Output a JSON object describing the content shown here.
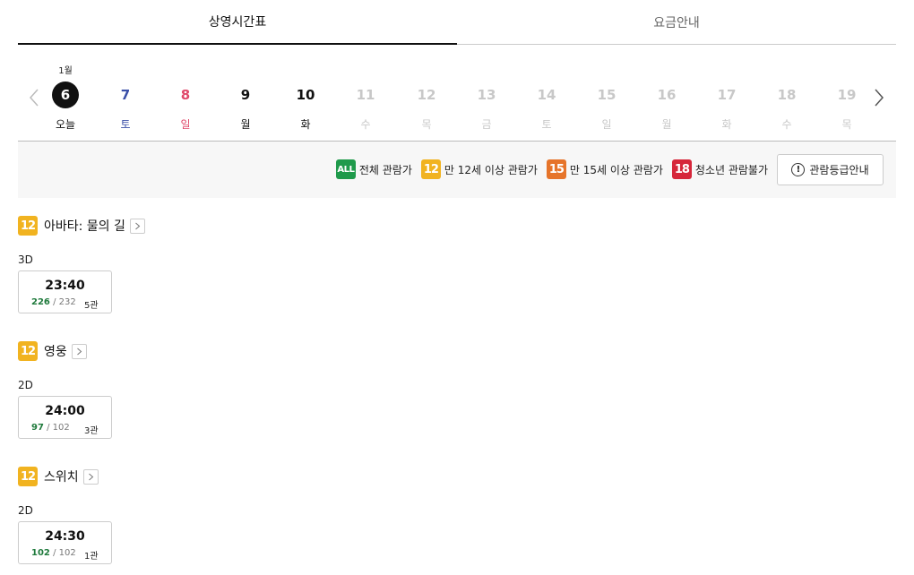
{
  "tabs": {
    "schedule": "상영시간표",
    "pricing": "요금안내"
  },
  "dates": {
    "month_label": "1월",
    "days": [
      {
        "num": "6",
        "weekday": "오늘",
        "state": "today"
      },
      {
        "num": "7",
        "weekday": "토",
        "state": "sat"
      },
      {
        "num": "8",
        "weekday": "일",
        "state": "sun"
      },
      {
        "num": "9",
        "weekday": "월",
        "state": "normal"
      },
      {
        "num": "10",
        "weekday": "화",
        "state": "normal"
      },
      {
        "num": "11",
        "weekday": "수",
        "state": "disabled"
      },
      {
        "num": "12",
        "weekday": "목",
        "state": "disabled"
      },
      {
        "num": "13",
        "weekday": "금",
        "state": "disabled"
      },
      {
        "num": "14",
        "weekday": "토",
        "state": "disabled"
      },
      {
        "num": "15",
        "weekday": "일",
        "state": "disabled"
      },
      {
        "num": "16",
        "weekday": "월",
        "state": "disabled"
      },
      {
        "num": "17",
        "weekday": "화",
        "state": "disabled"
      },
      {
        "num": "18",
        "weekday": "수",
        "state": "disabled"
      },
      {
        "num": "19",
        "weekday": "목",
        "state": "disabled"
      }
    ]
  },
  "ratings": {
    "all": {
      "badge": "ALL",
      "label": "전체 관람가",
      "color": "#1f9a4b"
    },
    "r12": {
      "badge": "12",
      "label": "만 12세 이상 관람가",
      "color": "#f1b320"
    },
    "r15": {
      "badge": "15",
      "label": "만 15세 이상 관람가",
      "color": "#e6742a"
    },
    "r18": {
      "badge": "18",
      "label": "청소년 관람불가",
      "color": "#d6263a"
    },
    "guide_button": "관람등급안내"
  },
  "movies": [
    {
      "rating": "12",
      "title": "아바타: 물의 길",
      "format": "3D",
      "time": "23:40",
      "remaining": "226",
      "total": "/ 232",
      "hall": "5관"
    },
    {
      "rating": "12",
      "title": "영웅",
      "format": "2D",
      "time": "24:00",
      "remaining": "97",
      "total": "/ 102",
      "hall": "3관"
    },
    {
      "rating": "12",
      "title": "스위치",
      "format": "2D",
      "time": "24:30",
      "remaining": "102",
      "total": "/ 102",
      "hall": "1관"
    }
  ]
}
